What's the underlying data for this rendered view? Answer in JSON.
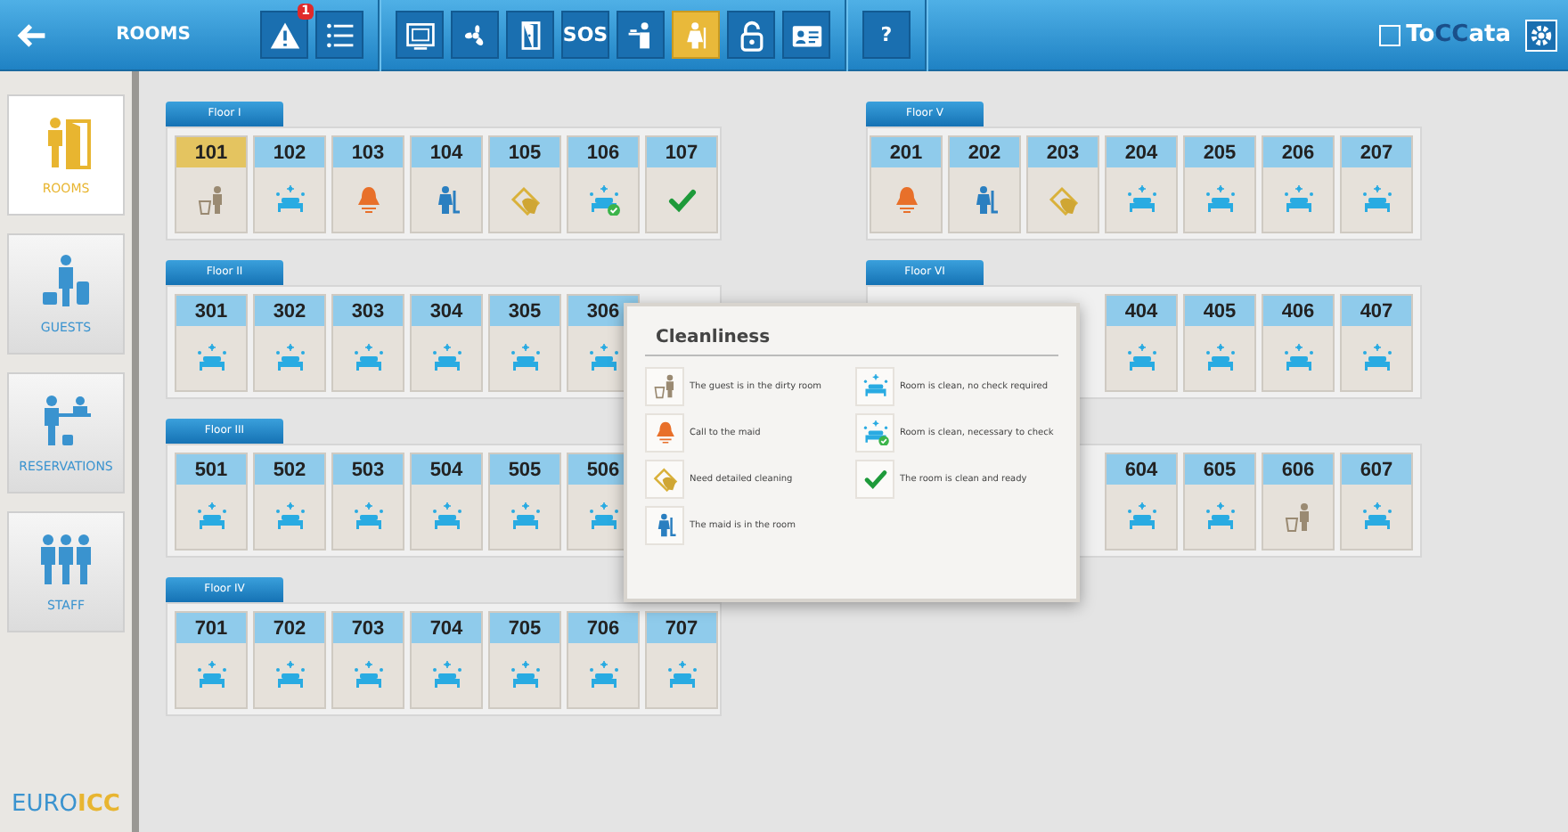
{
  "topbar": {
    "title": "ROOMS",
    "groups": [
      [
        {
          "kind": "alert",
          "badge": "1",
          "selected": false
        },
        {
          "kind": "list",
          "selected": false
        }
      ],
      [
        {
          "kind": "monitor",
          "selected": false
        },
        {
          "kind": "fan",
          "selected": false
        },
        {
          "kind": "door",
          "selected": false
        },
        {
          "kind": "text",
          "label": "SOS",
          "selected": false
        },
        {
          "kind": "waiter",
          "selected": false
        },
        {
          "kind": "maid",
          "selected": true
        },
        {
          "kind": "lock",
          "selected": false
        },
        {
          "kind": "card",
          "selected": false
        }
      ],
      [
        {
          "kind": "text",
          "label": "?",
          "selected": false
        }
      ]
    ],
    "brand": {
      "prefix": "To",
      "middle": "CC",
      "suffix": "ata"
    }
  },
  "sidebar": {
    "items": [
      {
        "kind": "rooms",
        "label": "ROOMS",
        "selected": true
      },
      {
        "kind": "guests",
        "label": "GUESTS",
        "selected": false
      },
      {
        "kind": "reservations",
        "label": "RESERVATIONS",
        "selected": false
      },
      {
        "kind": "staff",
        "label": "STAFF",
        "selected": false
      }
    ],
    "logo": {
      "light": "EURO",
      "bold": "ICC"
    }
  },
  "floors_left": [
    {
      "label": "Floor I",
      "rooms": [
        {
          "number": "101",
          "kind": "guest",
          "selected": true
        },
        {
          "number": "102",
          "kind": "clean",
          "selected": false
        },
        {
          "number": "103",
          "kind": "call",
          "selected": false
        },
        {
          "number": "104",
          "kind": "maid",
          "selected": false
        },
        {
          "number": "105",
          "kind": "detailed",
          "selected": false
        },
        {
          "number": "106",
          "kind": "clean_check",
          "selected": false
        },
        {
          "number": "107",
          "kind": "ready",
          "selected": false
        }
      ]
    },
    {
      "label": "Floor II",
      "rooms": [
        {
          "number": "301",
          "kind": "clean",
          "selected": false
        },
        {
          "number": "302",
          "kind": "clean",
          "selected": false
        },
        {
          "number": "303",
          "kind": "clean",
          "selected": false
        },
        {
          "number": "304",
          "kind": "clean",
          "selected": false
        },
        {
          "number": "305",
          "kind": "clean",
          "selected": false
        },
        {
          "number": "306",
          "kind": "clean",
          "selected": false
        }
      ]
    },
    {
      "label": "Floor III",
      "rooms": [
        {
          "number": "501",
          "kind": "clean",
          "selected": false
        },
        {
          "number": "502",
          "kind": "clean",
          "selected": false
        },
        {
          "number": "503",
          "kind": "clean",
          "selected": false
        },
        {
          "number": "504",
          "kind": "clean",
          "selected": false
        },
        {
          "number": "505",
          "kind": "clean",
          "selected": false
        },
        {
          "number": "506",
          "kind": "clean",
          "selected": false
        }
      ]
    },
    {
      "label": "Floor IV",
      "rooms": [
        {
          "number": "701",
          "kind": "clean",
          "selected": false
        },
        {
          "number": "702",
          "kind": "clean",
          "selected": false
        },
        {
          "number": "703",
          "kind": "clean",
          "selected": false
        },
        {
          "number": "704",
          "kind": "clean",
          "selected": false
        },
        {
          "number": "705",
          "kind": "clean",
          "selected": false
        },
        {
          "number": "706",
          "kind": "clean",
          "selected": false
        },
        {
          "number": "707",
          "kind": "clean",
          "selected": false
        }
      ]
    }
  ],
  "floors_right": [
    {
      "label": "Floor V",
      "rooms": [
        {
          "number": "201",
          "kind": "call",
          "selected": false
        },
        {
          "number": "202",
          "kind": "maid",
          "selected": false
        },
        {
          "number": "203",
          "kind": "detailed",
          "selected": false
        },
        {
          "number": "204",
          "kind": "clean",
          "selected": false
        },
        {
          "number": "205",
          "kind": "clean",
          "selected": false
        },
        {
          "number": "206",
          "kind": "clean",
          "selected": false
        },
        {
          "number": "207",
          "kind": "clean",
          "selected": false
        }
      ]
    },
    {
      "label": "Floor VI",
      "rooms": [
        {
          "number": "404",
          "kind": "clean",
          "selected": false
        },
        {
          "number": "405",
          "kind": "clean",
          "selected": false
        },
        {
          "number": "406",
          "kind": "clean",
          "selected": false
        },
        {
          "number": "407",
          "kind": "clean",
          "selected": false
        }
      ]
    },
    {
      "rooms": [
        {
          "number": "604",
          "kind": "clean",
          "selected": false
        },
        {
          "number": "605",
          "kind": "clean",
          "selected": false
        },
        {
          "number": "606",
          "kind": "guest",
          "selected": false
        },
        {
          "number": "607",
          "kind": "clean",
          "selected": false
        }
      ]
    }
  ],
  "legend": {
    "title": "Cleanliness",
    "columns": [
      [
        {
          "kind": "guest",
          "text": "The guest is in the dirty room"
        },
        {
          "kind": "call",
          "text": "Call to the maid"
        },
        {
          "kind": "detailed",
          "text": "Need detailed cleaning"
        },
        {
          "kind": "maid",
          "text": "The maid is in the room"
        }
      ],
      [
        {
          "kind": "clean",
          "text": "Room is clean, no check required"
        },
        {
          "kind": "clean_check",
          "text": "Room is clean, necessary to check"
        },
        {
          "kind": "ready",
          "text": "The room is clean and ready"
        }
      ]
    ]
  }
}
